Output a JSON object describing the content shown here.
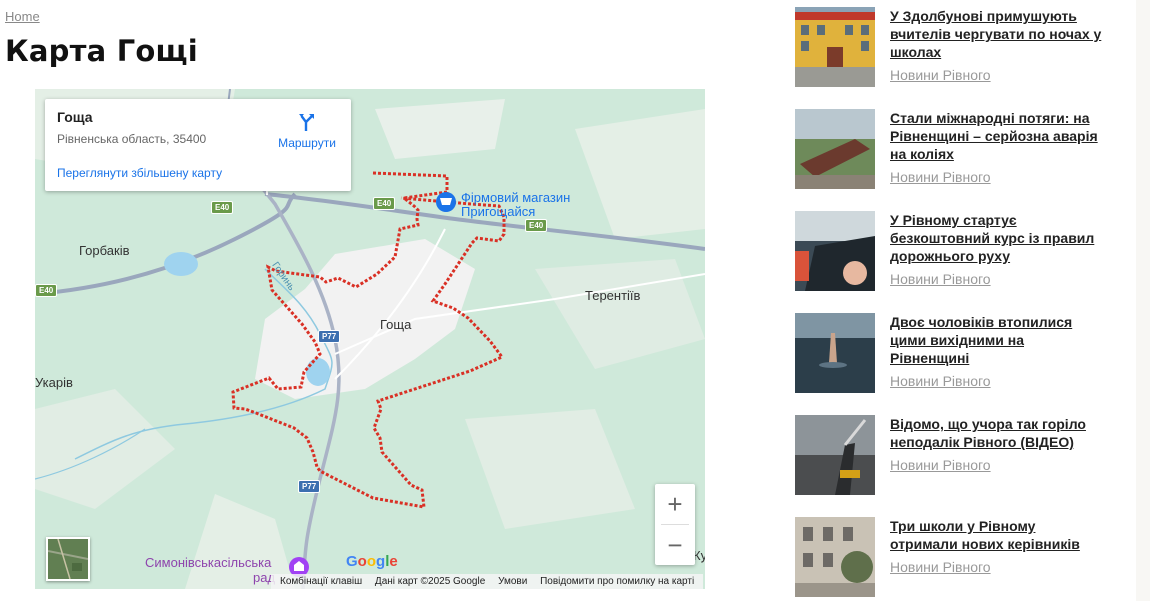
{
  "breadcrumb": {
    "home": "Home"
  },
  "page": {
    "title": "Карта Гощі"
  },
  "map": {
    "card_title": "Гоща",
    "card_subtitle": "Рівненська область, 35400",
    "routes_label": "Маршрути",
    "view_larger": "Переглянути збільшену карту",
    "places": {
      "gorbakiv": "Горбаків",
      "terentiiv": "Терентіїв",
      "hoshcha": "Гоща",
      "ukariv": "Укарів",
      "ku": "Ку",
      "river": "Горинь"
    },
    "poi_store_line1": "Фірмовий магазин",
    "poi_store_line2": "Пригощайся",
    "poi_bottom_line1": "Симонівськасільська",
    "poi_bottom_line2": "рад",
    "roads": {
      "e40": "E40",
      "p77": "P77"
    },
    "zoom_in": "+",
    "zoom_out": "−",
    "google": "Google",
    "attribution": {
      "shortcuts": "Комбінації клавіш",
      "data": "Дані карт ©2025 Google",
      "terms": "Умови",
      "report": "Повідомити про помилку на карті"
    }
  },
  "news": [
    {
      "title": "У Здолбунові примушують вчителів чергувати по ночах у школах",
      "category": "Новини Рівного"
    },
    {
      "title": "Стали міжнародні потяги: на Рівненщині – серйозна аварія на коліях",
      "category": "Новини Рівного"
    },
    {
      "title": "У Рівному стартує безкоштовний курс із правил дорожнього руху",
      "category": "Новини Рівного"
    },
    {
      "title": "Двоє чоловіків втопилися цими вихідними на Рівненщині",
      "category": "Новини Рівного"
    },
    {
      "title": "Відомо, що учора так горіло неподалік Рівного (ВІДЕО)",
      "category": "Новини Рівного"
    },
    {
      "title": "Три школи у Рівному отримали нових керівників",
      "category": "Новини Рівного"
    }
  ],
  "colors": {
    "link": "#1a73e8",
    "boundary": "#d93025",
    "map_green": "#cfe9da",
    "town": "#f2f2f2"
  }
}
